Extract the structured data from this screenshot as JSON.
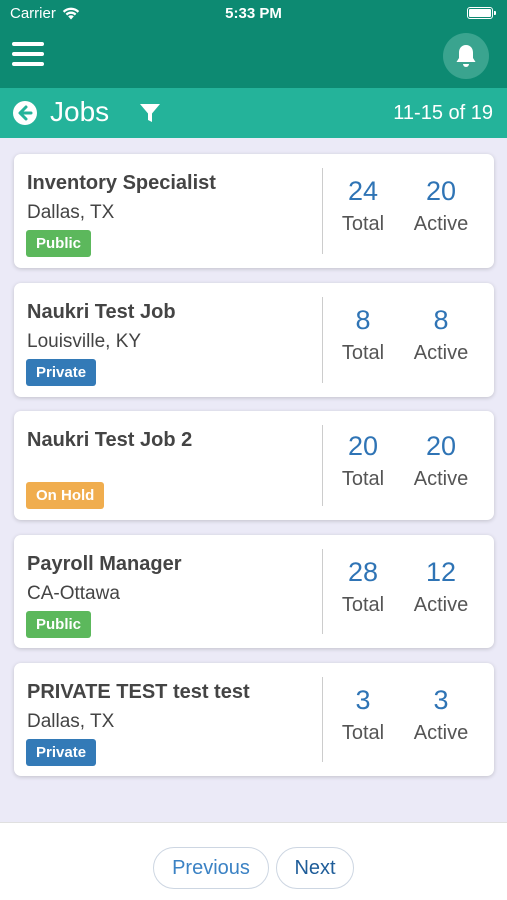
{
  "status_bar": {
    "carrier": "Carrier",
    "time": "5:33 PM"
  },
  "header": {
    "title": "Jobs",
    "range": "11-15 of 19",
    "icons": [
      "menu-icon",
      "bell-icon",
      "back-arrow-icon",
      "filter-icon"
    ]
  },
  "colors": {
    "app_bar": "#0d8a72",
    "sub_bar": "#24b39a",
    "public": "#5cb85c",
    "private": "#337ab7",
    "on_hold": "#f0ad4e",
    "stat_number": "#2f74b5"
  },
  "jobs": [
    {
      "title": "Inventory Specialist",
      "location": "Dallas, TX",
      "status": "Public",
      "total": "24",
      "total_label": "Total",
      "active": "20",
      "active_label": "Active"
    },
    {
      "title": "Naukri Test Job",
      "location": "Louisville, KY",
      "status": "Private",
      "total": "8",
      "total_label": "Total",
      "active": "8",
      "active_label": "Active"
    },
    {
      "title": "Naukri Test Job 2",
      "location": "",
      "status": "On Hold",
      "total": "20",
      "total_label": "Total",
      "active": "20",
      "active_label": "Active"
    },
    {
      "title": "Payroll Manager",
      "location": "CA-Ottawa",
      "status": "Public",
      "total": "28",
      "total_label": "Total",
      "active": "12",
      "active_label": "Active"
    },
    {
      "title": "PRIVATE TEST test test",
      "location": "Dallas, TX",
      "status": "Private",
      "total": "3",
      "total_label": "Total",
      "active": "3",
      "active_label": "Active"
    }
  ],
  "pagination": {
    "previous": "Previous",
    "next": "Next"
  }
}
